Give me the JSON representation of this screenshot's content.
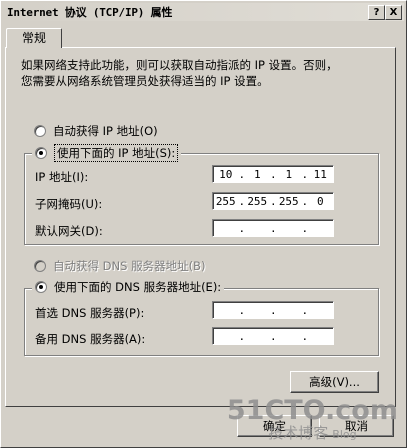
{
  "window": {
    "title": "Internet 协议 (TCP/IP) 属性",
    "help_label": "?",
    "close_label": "X"
  },
  "tabs": [
    {
      "label": "常规"
    }
  ],
  "intro": {
    "line1": "如果网络支持此功能，则可以获取自动指派的 IP 设置。否则，",
    "line2": "您需要从网络系统管理员处获得适当的 IP 设置。"
  },
  "ip_section": {
    "auto_label": "自动获得 IP 地址(O)",
    "manual_label": "使用下面的 IP 地址(S):",
    "selected": "manual",
    "fields": [
      {
        "label": "IP 地址(I):",
        "octets": [
          "10",
          "1",
          "1",
          "11"
        ]
      },
      {
        "label": "子网掩码(U):",
        "octets": [
          "255",
          "255",
          "255",
          "0"
        ]
      },
      {
        "label": "默认网关(D):",
        "octets": [
          "",
          "",
          "",
          ""
        ]
      }
    ]
  },
  "dns_section": {
    "auto_label": "自动获得 DNS 服务器地址(B)",
    "manual_label": "使用下面的 DNS 服务器地址(E):",
    "selected": "manual",
    "fields": [
      {
        "label": "首选 DNS 服务器(P):",
        "octets": [
          "",
          "",
          "",
          ""
        ]
      },
      {
        "label": "备用 DNS 服务器(A):",
        "octets": [
          "",
          "",
          "",
          ""
        ]
      }
    ]
  },
  "buttons": {
    "advanced": "高级(V)...",
    "ok": "确定",
    "cancel": "取消"
  },
  "watermark": {
    "main": "51CTO.com",
    "sub": "技术博客",
    "blog": "Blog"
  }
}
